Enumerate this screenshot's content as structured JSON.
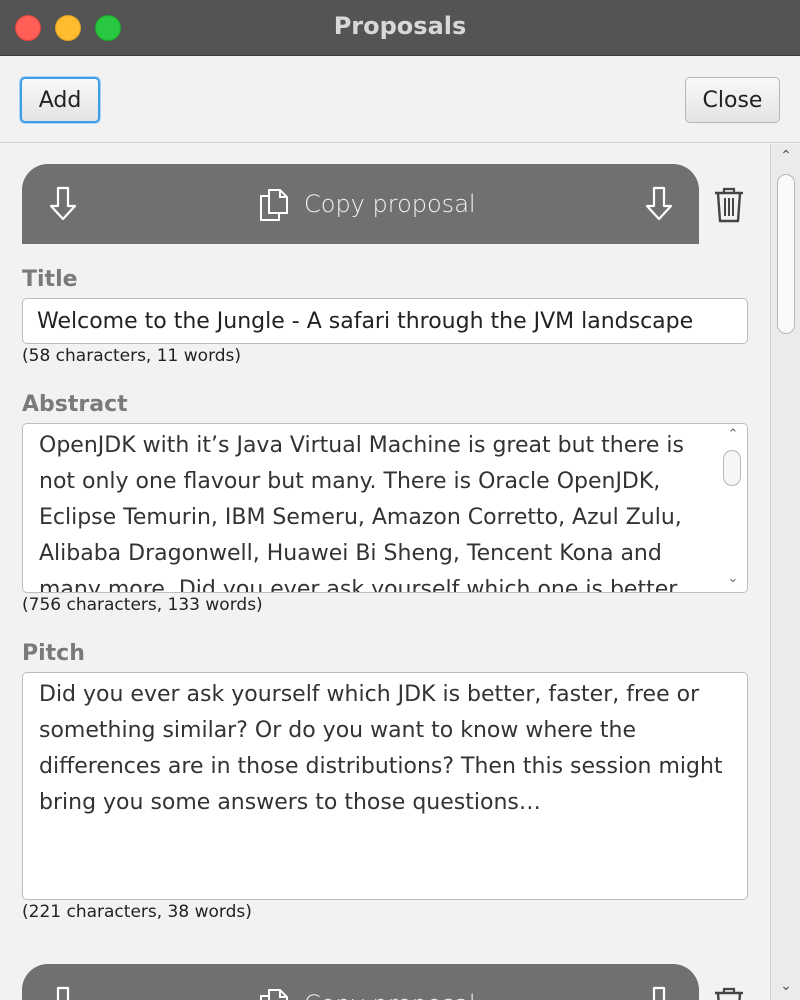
{
  "window": {
    "title": "Proposals"
  },
  "toolbar": {
    "add_label": "Add",
    "close_label": "Close"
  },
  "proposal": {
    "copy_label": "Copy proposal",
    "title_label": "Title",
    "title_value": "Welcome to the Jungle - A safari through the JVM landscape",
    "title_counter": "(58 characters, 11 words)",
    "abstract_label": "Abstract",
    "abstract_value": "OpenJDK with it’s Java Virtual Machine is great but there is not only one flavour but many. There is Oracle OpenJDK, Eclipse Temurin, IBM Semeru, Amazon Corretto, Azul Zulu, Alibaba Dragonwell, Huawei Bi Sheng, Tencent Kona and many more. Did you ever ask yourself which one is better",
    "abstract_counter": "(756 characters, 133 words)",
    "pitch_label": "Pitch",
    "pitch_value": "Did you ever ask yourself which JDK is better, faster, free or something similar? Or do you want to know where the differences are in those distributions? Then this session might bring you some answers to those questions…",
    "pitch_counter": "(221 characters, 38 words)"
  },
  "next_proposal": {
    "copy_label": "Copy proposal"
  },
  "icons": {
    "download": "download-icon",
    "copy": "copy-icon",
    "trash": "trash-icon"
  },
  "colors": {
    "titlebar": "#545454",
    "banner": "#707070",
    "focus": "#3d9ee8"
  }
}
